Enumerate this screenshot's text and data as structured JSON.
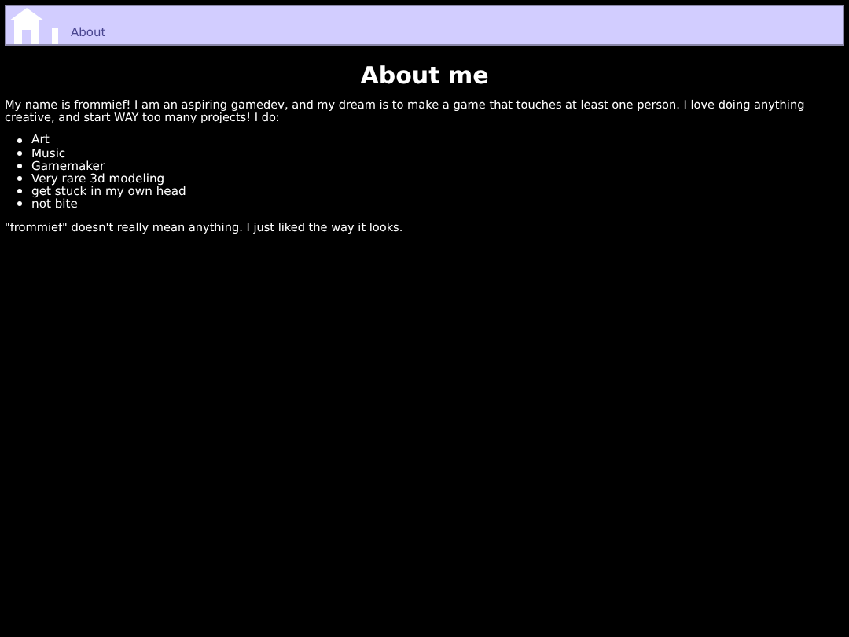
{
  "nav": {
    "links": [
      "About"
    ]
  },
  "title": "About me",
  "intro": "My name is frommief! I am an aspiring gamedev, and my dream is to make a game that touches at least one person. I love doing anything creative, and start WAY too many projects! I do:",
  "list": [
    "Art",
    "Music",
    "Gamemaker",
    "Very rare 3d modeling",
    "get stuck in my own head",
    "not bite"
  ],
  "note": "\"frommief\" doesn't really mean anything. I just liked the way it looks."
}
